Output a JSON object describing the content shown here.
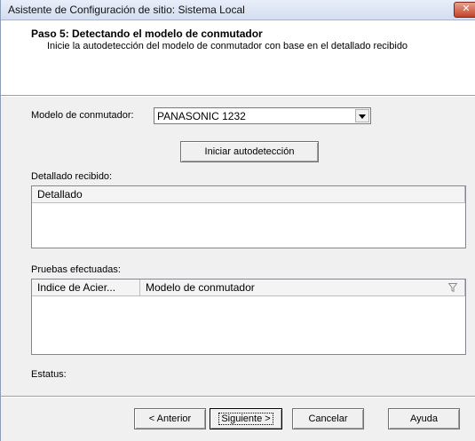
{
  "window": {
    "title": "Asistente de Configuración de sitio: Sistema Local",
    "close_label": "✕"
  },
  "header": {
    "step_title": "Paso 5: Detectando el modelo de conmutador",
    "step_description": "Inicie la autodetección del modelo de conmutador con base en el detallado recibido"
  },
  "form": {
    "model_label": "Modelo de conmutador:",
    "model_value": "PANASONIC 1232",
    "autodetect_button": "Iniciar autodetección",
    "received_label": "Detallado recibido:",
    "received_columns": [
      "Detallado"
    ],
    "tests_label": "Pruebas efectuadas:",
    "tests_columns": [
      "Indice de Acier...",
      "Modelo de conmutador"
    ],
    "status_label": "Estatus:"
  },
  "footer": {
    "back_button": "< Anterior",
    "next_button": "Siguiente >",
    "cancel_button": "Cancelar",
    "help_button": "Ayuda"
  },
  "icons": {
    "close": "close-icon",
    "dropdown": "chevron-down-icon",
    "filter": "filter-icon"
  }
}
